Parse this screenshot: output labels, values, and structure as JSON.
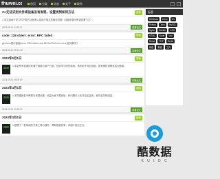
{
  "site": {
    "logo": "fhuwei.cc"
  },
  "nav": [
    "首页",
    "分类",
    "动态",
    "关于",
    "联系"
  ],
  "posts": [
    {
      "title": "Cn无法识别文件或设备没有发现，设置找到如何方法",
      "badge": "阅读",
      "excerpt": "1.本文适用于学习时下载方法参考以及用户常见的报告问题（详细步骤示例请查看下方）。",
      "date": "2023-05-12 14:22:11",
      "more": "阅读全文"
    },
    {
      "title": "code: 128 stderr: error: RPC failed",
      "badge": "阅读",
      "excerpt": "git clone提示错误(error: RPC failed; curl 56 GnuTLS recv error)如何解决？",
      "date": "2023-05-10 09:13:45",
      "more": "阅读全文"
    },
    {
      "title": "2023年5月1日",
      "badge": "阅读",
      "excerpt": "1.本站所有资源均来源于网络与用户分享，仅供学习研究使用，请勿用于商业用途，如有侵权请联系站长删除。",
      "date": "2023-05-01 08:00:00",
      "more": "阅读全文"
    },
    {
      "title": "2023年4月1日",
      "badge": "阅读",
      "excerpt": "1.本周更新若干教程与资源合集，欢迎大家下载阅读，有问题可以在评论区留言，我们会尽快回复。",
      "date": "2023-04-01 10:30:20",
      "more": "阅读全文"
    },
    {
      "title": "2023年3月1日",
      "badge": "阅读",
      "excerpt": "1.整理了一批常用的开发工具与插件，帮助提高效率，详细介绍见正文。",
      "date": "2023-03-01 12:00:00",
      "more": "阅读全文"
    }
  ],
  "sidebar": {
    "title": "标签",
    "tags": [
      "Windows",
      "Linux",
      "Git",
      "Python",
      "Java",
      "MySQL",
      "Nginx",
      "Docker",
      "CSS",
      "HTML",
      "Node",
      "Vue",
      "React",
      "PHP",
      "Redis",
      "网络",
      "教程",
      "工具"
    ]
  },
  "watermark": {
    "text": "酷数据",
    "sub": "K U I D C"
  }
}
